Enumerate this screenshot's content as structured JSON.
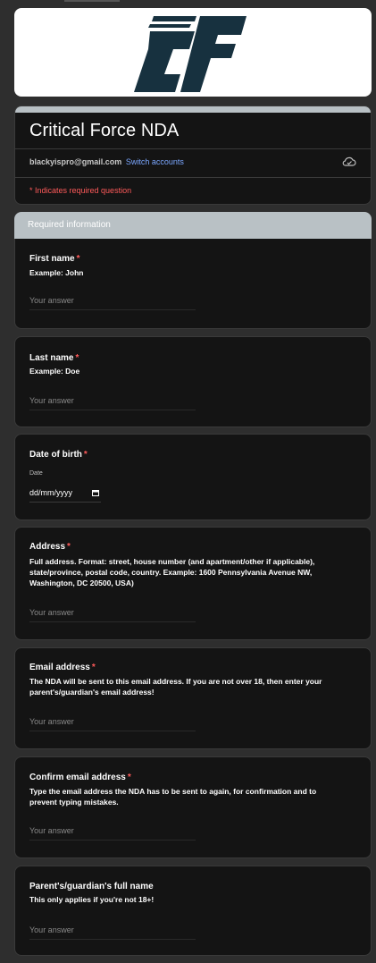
{
  "form": {
    "title": "Critical Force NDA",
    "account_email": "blackyispro@gmail.com",
    "switch_accounts": "Switch accounts",
    "required_note": "* Indicates required question",
    "section_header": "Required information",
    "answer_placeholder": "Your answer",
    "logo_text": "CF"
  },
  "questions": [
    {
      "label": "First name",
      "required_mark": "*",
      "help": "Example: John",
      "placeholder": "Your answer"
    },
    {
      "label": "Last name",
      "required_mark": "*",
      "help": "Example: Doe",
      "placeholder": "Your answer"
    },
    {
      "label": "Date of birth",
      "required_mark": "*",
      "caption": "Date",
      "date_placeholder": "dd/mm/yyyy"
    },
    {
      "label": "Address",
      "required_mark": "*",
      "help": "Full address. Format: street, house number (and apartment/other if applicable), state/province, postal code, country. Example: 1600 Pennsylvania Avenue NW, Washington, DC 20500, USA)",
      "placeholder": "Your answer"
    },
    {
      "label": "Email address",
      "required_mark": "*",
      "help": "The NDA will be sent to this email address. If you are not over 18, then enter your parent's/guardian's email address!",
      "placeholder": "Your answer"
    },
    {
      "label": "Confirm email address",
      "required_mark": "*",
      "help": "Type the email address the NDA has to be sent to again, for confirmation and to prevent typing mistakes.",
      "placeholder": "Your answer"
    },
    {
      "label": "Parent's/guardian's full name",
      "help": "This only applies if you're not 18+!",
      "placeholder": "Your answer"
    }
  ],
  "colors": {
    "background": "#2e2e2e",
    "card": "#141414",
    "accent_header": "#b9c1c5",
    "required": "#ff5a5a",
    "link": "#7ba7ff",
    "logo": "#17313f"
  }
}
